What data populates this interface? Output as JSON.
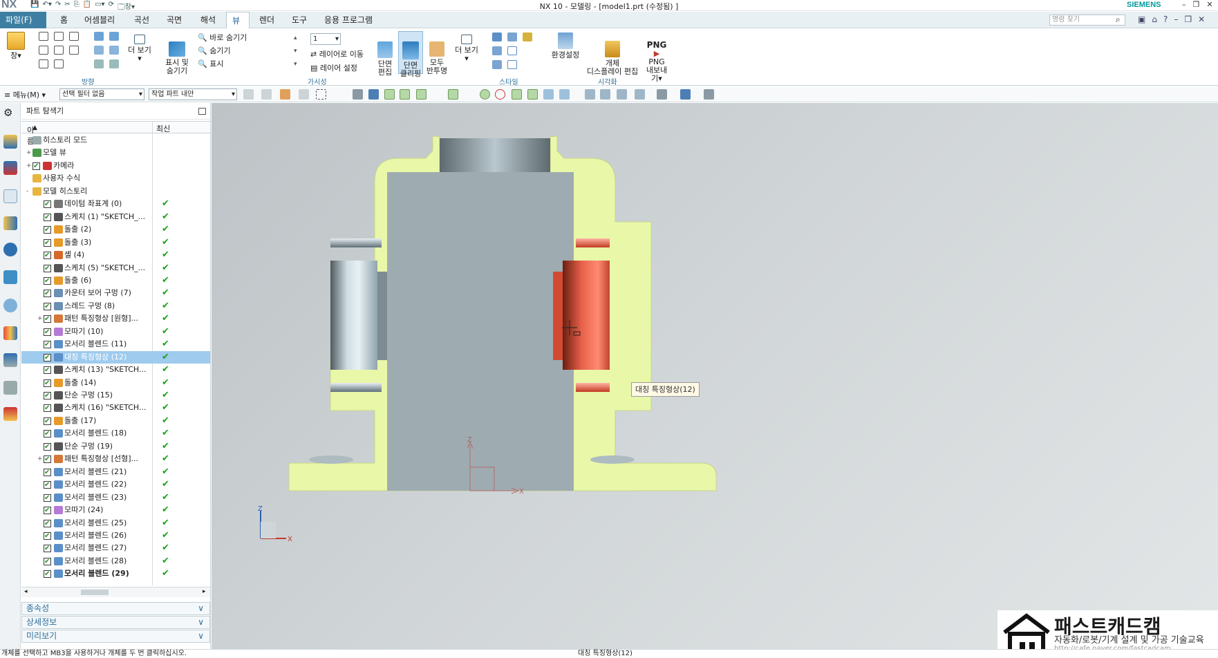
{
  "app": {
    "logo": "NX",
    "title": "NX 10 - 모델링 - [model1.prt (수정됨) ]",
    "brand": "SIEMENS",
    "window_label": "창"
  },
  "tabs": [
    "파일(F)",
    "홈",
    "어셈블리",
    "곡선",
    "곡면",
    "해석",
    "뷰",
    "렌더",
    "도구",
    "응용 프로그램"
  ],
  "active_tab": "뷰",
  "search_placeholder": "명령 찾기",
  "ribbon": {
    "window_btn": "창",
    "more1": "더 보기",
    "orient_group": "방향",
    "showhide": "표시 및\n숨기기",
    "hide_quick": "바로 숨기기",
    "hide": "숨기기",
    "show": "표시",
    "layer_value": "1",
    "move_layer": "레이어로 이동",
    "layer_settings": "레이어 설정",
    "visibility_group": "가시성",
    "section_edit": "단면\n편집",
    "section_clip": "단면\n클리핑",
    "all_reflect": "모두\n반투명",
    "more2": "더 보기",
    "style_group": "스타일",
    "env": "환경설정",
    "obj_display": "개체\n디스플레이 편집",
    "png_label": "PNG",
    "png_export": "PNG\n내보내기",
    "vis_group": "시각화"
  },
  "toolbar": {
    "menu": "메뉴(M)",
    "filter": "선택 필터 없음",
    "scope": "작업 파트 내만"
  },
  "navigator": {
    "title": "파트 탐색기",
    "col_name": "이름",
    "col_latest": "최신",
    "rows": [
      {
        "label": "히스토리 모드",
        "indent": 0,
        "exp": "",
        "check": false,
        "icon": "clock-icon",
        "ok": false
      },
      {
        "label": "모델 뷰",
        "indent": 0,
        "exp": "+",
        "check": false,
        "icon": "model-view-icon",
        "ok": false
      },
      {
        "label": "카메라",
        "indent": 0,
        "exp": "+",
        "check": true,
        "icon": "camera-icon",
        "ok": false
      },
      {
        "label": "사용자 수식",
        "indent": 0,
        "exp": "",
        "check": false,
        "icon": "folder-icon",
        "ok": false
      },
      {
        "label": "모델 히스토리",
        "indent": 0,
        "exp": "-",
        "check": false,
        "icon": "folder-icon",
        "ok": false
      },
      {
        "label": "데이텀 좌표계 (0)",
        "indent": 1,
        "exp": "",
        "check": true,
        "icon": "datum-csys-icon",
        "ok": true
      },
      {
        "label": "스케치 (1) \"SKETCH_...",
        "indent": 1,
        "exp": "",
        "check": true,
        "icon": "sketch-icon",
        "ok": true
      },
      {
        "label": "돌출 (2)",
        "indent": 1,
        "exp": "",
        "check": true,
        "icon": "extrude-icon",
        "ok": true
      },
      {
        "label": "돌출 (3)",
        "indent": 1,
        "exp": "",
        "check": true,
        "icon": "extrude-icon",
        "ok": true
      },
      {
        "label": "셸 (4)",
        "indent": 1,
        "exp": "",
        "check": true,
        "icon": "shell-icon",
        "ok": true
      },
      {
        "label": "스케치 (5) \"SKETCH_...",
        "indent": 1,
        "exp": "",
        "check": true,
        "icon": "sketch-icon",
        "ok": true
      },
      {
        "label": "돌출 (6)",
        "indent": 1,
        "exp": "",
        "check": true,
        "icon": "extrude-icon",
        "ok": true
      },
      {
        "label": "카운터 보어 구멍 (7)",
        "indent": 1,
        "exp": "",
        "check": true,
        "icon": "hole-icon",
        "ok": true
      },
      {
        "label": "스레드 구멍 (8)",
        "indent": 1,
        "exp": "",
        "check": true,
        "icon": "thread-icon",
        "ok": true
      },
      {
        "label": "패턴 특징형상 [원형]...",
        "indent": 1,
        "exp": "+",
        "check": true,
        "icon": "pattern-icon",
        "ok": true
      },
      {
        "label": "모따기 (10)",
        "indent": 1,
        "exp": "",
        "check": true,
        "icon": "chamfer-icon",
        "ok": true
      },
      {
        "label": "모서리 블렌드 (11)",
        "indent": 1,
        "exp": "",
        "check": true,
        "icon": "blend-icon",
        "ok": true
      },
      {
        "label": "대칭 특징형상 (12)",
        "indent": 1,
        "exp": "",
        "check": true,
        "icon": "mirror-icon",
        "ok": true,
        "selected": true
      },
      {
        "label": "스케치 (13) \"SKETCH...",
        "indent": 1,
        "exp": "",
        "check": true,
        "icon": "sketch-icon",
        "ok": true
      },
      {
        "label": "돌출 (14)",
        "indent": 1,
        "exp": "",
        "check": true,
        "icon": "extrude-icon",
        "ok": true
      },
      {
        "label": "단순 구멍 (15)",
        "indent": 1,
        "exp": "",
        "check": true,
        "icon": "simple-hole-icon",
        "ok": true
      },
      {
        "label": "스케치 (16) \"SKETCH...",
        "indent": 1,
        "exp": "",
        "check": true,
        "icon": "sketch-icon",
        "ok": true
      },
      {
        "label": "돌출 (17)",
        "indent": 1,
        "exp": "",
        "check": true,
        "icon": "extrude-icon",
        "ok": true
      },
      {
        "label": "모서리 블렌드 (18)",
        "indent": 1,
        "exp": "",
        "check": true,
        "icon": "blend-icon",
        "ok": true
      },
      {
        "label": "단순 구멍 (19)",
        "indent": 1,
        "exp": "",
        "check": true,
        "icon": "simple-hole-icon",
        "ok": true
      },
      {
        "label": "패턴 특징형상 [선형]...",
        "indent": 1,
        "exp": "+",
        "check": true,
        "icon": "pattern-icon",
        "ok": true
      },
      {
        "label": "모서리 블렌드 (21)",
        "indent": 1,
        "exp": "",
        "check": true,
        "icon": "blend-icon",
        "ok": true
      },
      {
        "label": "모서리 블렌드 (22)",
        "indent": 1,
        "exp": "",
        "check": true,
        "icon": "blend-icon",
        "ok": true
      },
      {
        "label": "모서리 블렌드 (23)",
        "indent": 1,
        "exp": "",
        "check": true,
        "icon": "blend-icon",
        "ok": true
      },
      {
        "label": "모따기 (24)",
        "indent": 1,
        "exp": "",
        "check": true,
        "icon": "chamfer-icon",
        "ok": true
      },
      {
        "label": "모서리 블렌드 (25)",
        "indent": 1,
        "exp": "",
        "check": true,
        "icon": "blend-icon",
        "ok": true
      },
      {
        "label": "모서리 블렌드 (26)",
        "indent": 1,
        "exp": "",
        "check": true,
        "icon": "blend-icon",
        "ok": true
      },
      {
        "label": "모서리 블렌드 (27)",
        "indent": 1,
        "exp": "",
        "check": true,
        "icon": "blend-icon",
        "ok": true
      },
      {
        "label": "모서리 블렌드 (28)",
        "indent": 1,
        "exp": "",
        "check": true,
        "icon": "blend-icon",
        "ok": true
      },
      {
        "label": "모서리 블렌드 (29)",
        "indent": 1,
        "exp": "",
        "check": true,
        "icon": "blend-icon",
        "ok": true,
        "bold": true
      }
    ],
    "panels": [
      "종속성",
      "상세정보",
      "미리보기"
    ]
  },
  "viewport": {
    "tooltip": "대칭 특징형상(12)",
    "axis_x": "X",
    "axis_z": "Z",
    "triad_x": "X",
    "triad_z": "Z"
  },
  "status": {
    "left": "개체를 선택하고 MB3을 사용하거나 개체를 두 번 클릭하십시오.",
    "center": "대칭 특징형상(12)"
  },
  "watermark": {
    "title": "패스트캐드캠",
    "subtitle": "자동화/로봇/기계 설계 및 가공 기술교육",
    "url": "http://cafe.naver.com/fastcadcam"
  },
  "colors": {
    "accent": "#3d7fa3",
    "body_section": "#e9f7a9",
    "cut_highlight": "#f57a62",
    "solid": "#9eacb1",
    "selection": "#9ecbee",
    "check": "#1aa31a"
  }
}
